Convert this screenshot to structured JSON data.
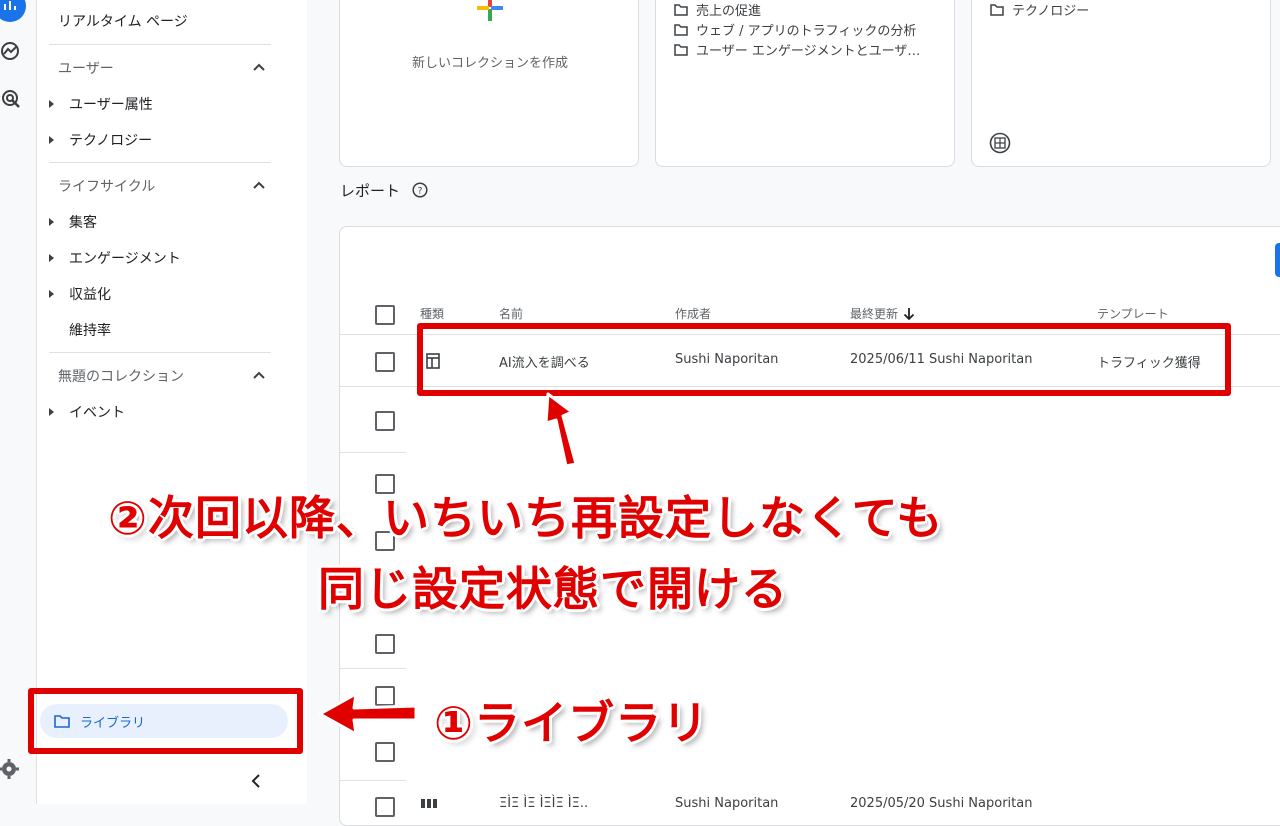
{
  "nav": {
    "realtime_pages": "リアルタイム ページ",
    "sections": [
      {
        "title": "ユーザー",
        "items": [
          "ユーザー属性",
          "テクノロジー"
        ]
      },
      {
        "title": "ライフサイクル",
        "items": [
          "集客",
          "エンゲージメント",
          "収益化",
          "維持率"
        ]
      },
      {
        "title": "無題のコレクション",
        "items": [
          "イベント"
        ]
      }
    ],
    "library": "ライブラリ"
  },
  "cards": {
    "new_collection": "新しいコレクションを作成",
    "card2_items": [
      "売上の促進",
      "ウェブ / アプリのトラフィックの分析",
      "ユーザー エンゲージメントとユーザ…"
    ],
    "card3_items": [
      "テクノロジー"
    ]
  },
  "reports": {
    "title": "レポート",
    "columns": {
      "type": "種類",
      "name": "名前",
      "creator": "作成者",
      "last_modified": "最終更新",
      "template": "テンプレート"
    },
    "row": {
      "name": "AI流入を調べる",
      "creator": "Sushi Naporitan",
      "modified": "2025/06/11 Sushi Naporitan",
      "template": "トラフィック獲得"
    },
    "partial_row": {
      "name": "ΞÌΞ ÌΞ ÌΞÌΞ ÌΞ..",
      "creator": "Sushi Naporitan",
      "modified": "2025/05/20 Sushi Naporitan"
    }
  },
  "annotations": {
    "step2_line1": "②次回以降、いちいち再設定しなくても",
    "step2_line2": "同じ設定状態で開ける",
    "step1": "①ライブラリ"
  },
  "colors": {
    "accent_red": "#e10000",
    "brand_blue": "#1a73e8",
    "library_bg": "#e8f0fe"
  }
}
